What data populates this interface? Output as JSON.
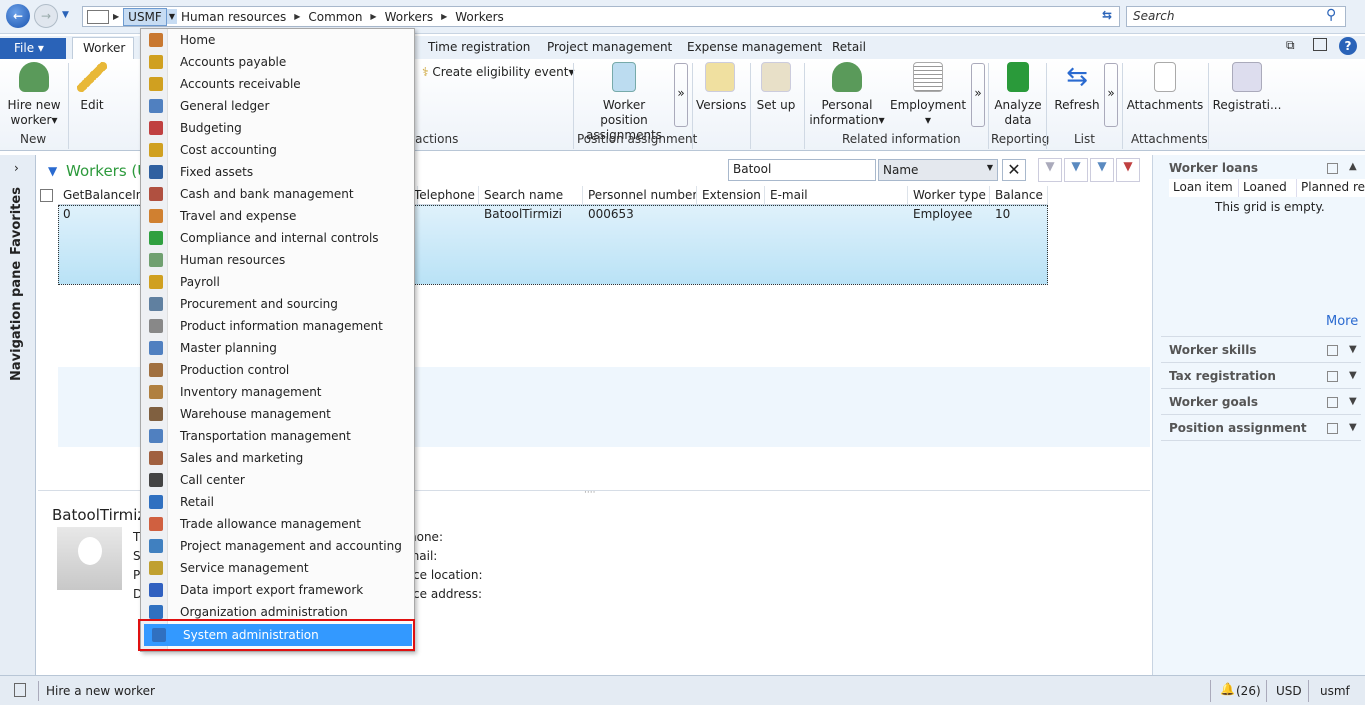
{
  "nav": {
    "back_icon": "back-arrow-icon",
    "forward_icon": "forward-arrow-icon"
  },
  "address": {
    "company": "USMF",
    "crumbs": [
      "Human resources",
      "Common",
      "Workers",
      "Workers"
    ]
  },
  "search": {
    "placeholder": "Search"
  },
  "tabs": {
    "file": "File",
    "active": "Worker",
    "others": [
      "Time registration",
      "Project management",
      "Expense management",
      "Retail"
    ]
  },
  "ribbon": {
    "hire": "Hire new worker",
    "new_group": "New",
    "edit": "Edit",
    "create_eligibility": "Create eligibility event",
    "actions_group": "l actions",
    "worker_position": "Worker position assignments",
    "position_group": "Position assignment",
    "versions": "Versions",
    "setup": "Set up",
    "personal": "Personal information",
    "employment": "Employment",
    "related_group": "Related information",
    "analyze": "Analyze data",
    "reporting_group": "Reporting",
    "refresh": "Refresh",
    "list_group": "List",
    "attachments": "Attachments",
    "attachments_group": "Attachments",
    "registration": "Registrati..."
  },
  "navpane": {
    "favorites": "Favorites",
    "navigation": "Navigation pane"
  },
  "grid": {
    "title": "Workers (Ur",
    "filter_value": "Batool",
    "filter_field": "Name",
    "columns": [
      "GetBalanceInt",
      "Telephone",
      "Search name",
      "Personnel number",
      "Extension",
      "E-mail",
      "Worker type",
      "Balance"
    ],
    "row": {
      "balance_int": "0",
      "search_name": "BatoolTirmizi",
      "personnel_number": "000653",
      "worker_type": "Employee",
      "balance": "10"
    }
  },
  "details": {
    "name": "BatoolTirmizi",
    "left_labels": [
      "Ti",
      "St",
      "Po",
      "De"
    ],
    "right_labels": [
      "Telephone:",
      "Email:",
      "Office location:",
      "Office address:"
    ]
  },
  "menu": {
    "items": [
      "Home",
      "Accounts payable",
      "Accounts receivable",
      "General ledger",
      "Budgeting",
      "Cost accounting",
      "Fixed assets",
      "Cash and bank management",
      "Travel and expense",
      "Compliance and internal controls",
      "Human resources",
      "Payroll",
      "Procurement and sourcing",
      "Product information management",
      "Master planning",
      "Production control",
      "Inventory management",
      "Warehouse management",
      "Transportation management",
      "Sales and marketing",
      "Call center",
      "Retail",
      "Trade allowance management",
      "Project management and accounting",
      "Service management",
      "Data import export framework",
      "Organization administration",
      "System administration"
    ],
    "selected": "System administration",
    "highlight_color": "#3399ff",
    "callout_color": "#e01010"
  },
  "factbox": {
    "loans_title": "Worker loans",
    "loan_cols": [
      "Loan item",
      "Loaned",
      "Planned re"
    ],
    "empty": "This grid is empty.",
    "more": "More",
    "sections": [
      "Worker skills",
      "Tax registration",
      "Worker goals",
      "Position assignment"
    ]
  },
  "status": {
    "text": "Hire a new worker",
    "alerts": "(26)",
    "currency": "USD",
    "company": "usmf"
  }
}
